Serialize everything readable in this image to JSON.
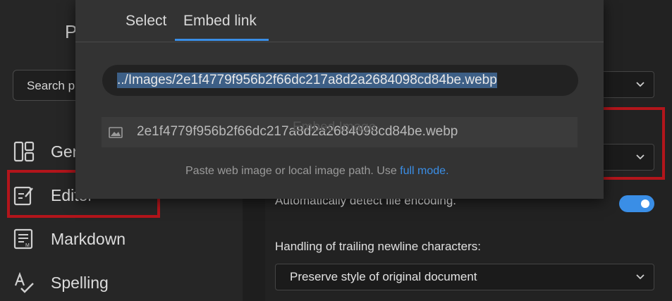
{
  "sidebar": {
    "app_title": "P",
    "search_placeholder": "Search p",
    "items": [
      {
        "label": "Gen",
        "icon": "layout-grid-icon"
      },
      {
        "label": "Editor",
        "icon": "edit-icon"
      },
      {
        "label": "Markdown",
        "icon": "markdown-doc-icon"
      },
      {
        "label": "Spelling",
        "icon": "spellcheck-icon"
      }
    ]
  },
  "main": {
    "encoding_label": "Automatically detect file encoding.",
    "encoding_enabled": true,
    "trailing_newline_label": "Handling of trailing newline characters:",
    "trailing_newline_value": "Preserve style of original document"
  },
  "modal": {
    "tabs": [
      "Select",
      "Embed link"
    ],
    "active_tab": "Embed link",
    "url_value": "../Images/2e1f4779f956b2f66dc217a8d2a2684098cd84be.webp",
    "suggestion": "2e1f4779f956b2f66dc217a8d2a2684098cd84be.webp",
    "ghost_title": "Embed Image",
    "hint_text": "Paste web image or local image path. Use ",
    "hint_link": "full mode."
  },
  "colors": {
    "accent": "#3a8ee6",
    "highlight_border": "#b3151b"
  }
}
